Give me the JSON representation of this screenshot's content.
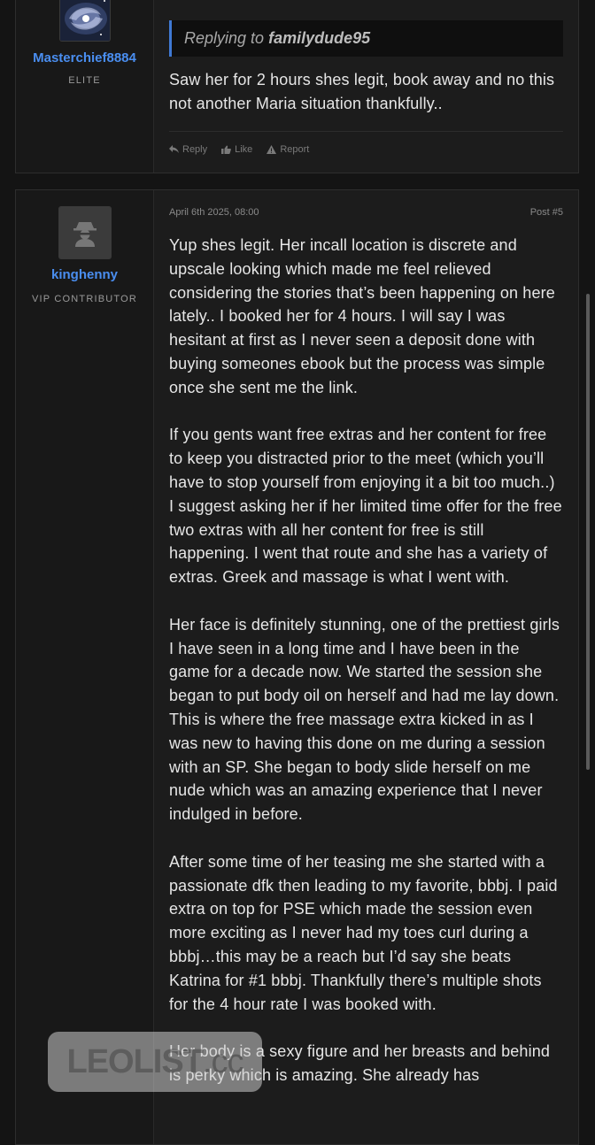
{
  "post1": {
    "username": "Masterchief8884",
    "user_title": "ELITE",
    "quote_prefix": "Replying to",
    "quote_user": "familydude95",
    "body": "Saw her for 2 hours shes legit, book away and no this not another Maria situation thankfully..",
    "actions": [
      "Reply",
      "Like",
      "Report"
    ]
  },
  "post2": {
    "username": "kinghenny",
    "user_title": "VIP CONTRIBUTOR",
    "date": "April 6th 2025, 08:00",
    "post_number": "Post #5",
    "paragraphs": [
      "Yup shes legit. Her incall location is discrete and upscale looking which made me feel relieved considering the stories that’s been happening on here lately.. I booked her for 4 hours. I will say I was hesitant at first as I never seen a deposit done with buying someones ebook but the process was simple once she sent me the link.",
      "If you gents want free extras and her content for free to keep you distracted prior to the meet (which you’ll have to stop yourself from enjoying it a bit too much..) I suggest asking her if her limited time offer for the free two extras with all her content for free is still happening. I went that route and she has a variety of extras. Greek and massage is what I went with.",
      "Her face is definitely stunning, one of the prettiest girls I have seen in a long time and I have been in the game for a decade now. We started the session she began to put body oil on herself and had me lay down. This is where the free massage extra kicked in as I was new to having this done on me during a session with an SP. She began to body slide herself on me nude which was an amazing experience that I never indulged in before.",
      "After some time of her teasing me she started with a passionate dfk then leading to my favorite, bbbj. I paid extra on top for PSE which made the session even more exciting as I never had my toes curl during a bbbj…this may be a reach but I’d say she beats Katrina for #1 bbbj. Thankfully there’s multiple shots for the 4 hour rate I was booked with.",
      "Her body is a sexy figure and her breasts and behind is perky which is amazing. She already has"
    ]
  },
  "watermark": {
    "brand": "LEOLIST",
    "suffix": ".cc"
  }
}
